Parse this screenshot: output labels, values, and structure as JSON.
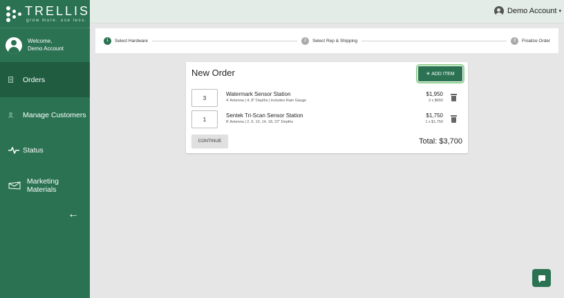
{
  "brand": {
    "name": "TRELLIS",
    "tagline": "grow more. use less.",
    "color": "#2a7252"
  },
  "sidebar": {
    "welcome_line1": "Welcome,",
    "welcome_line2": "Demo Account",
    "items": [
      {
        "label": "Orders",
        "icon": "document-icon",
        "active": true
      },
      {
        "label": "Manage Customers",
        "icon": "person-icon",
        "active": false
      },
      {
        "label": "Status",
        "icon": "pulse-icon",
        "active": false
      },
      {
        "label": "Marketing Materials",
        "icon": "megaphone-icon",
        "active": false
      }
    ],
    "back_icon": "←"
  },
  "header": {
    "account_name": "Demo Account",
    "caret": "▾"
  },
  "stepper": {
    "steps": [
      {
        "num": "1",
        "label": "Select Hardware",
        "active": true
      },
      {
        "num": "2",
        "label": "Select Rep & Shipping",
        "active": false
      },
      {
        "num": "3",
        "label": "Finalize Order",
        "active": false
      }
    ]
  },
  "order": {
    "title": "New Order",
    "add_item_label": "ADD ITEM",
    "add_item_icon": "+",
    "items": [
      {
        "qty": "3",
        "name": "Watermark Sensor Station",
        "desc": "4' Antenna | 4, 8\" Depths | Includes Rain Gauge",
        "price": "$1,950",
        "unit": "3 x $650"
      },
      {
        "qty": "1",
        "name": "Sentek Tri-Scan Sensor Station",
        "desc": "8' Antenna | 2, 6, 10, 14, 18, 22\" Depths",
        "price": "$1,750",
        "unit": "1 x $1,750"
      }
    ],
    "continue_label": "CONTINUE",
    "total": "Total: $3,700"
  }
}
